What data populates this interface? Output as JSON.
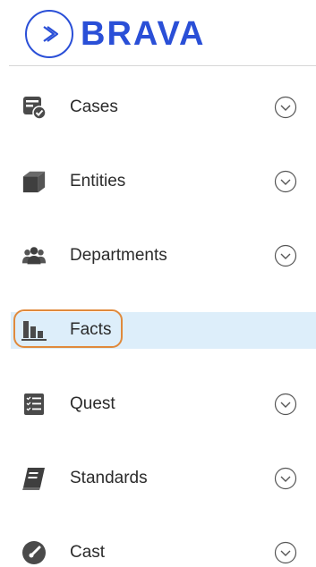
{
  "brand": {
    "name": "BRAVA"
  },
  "nav": {
    "items": [
      {
        "label": "Cases",
        "icon": "cases-icon",
        "has_chevron": true
      },
      {
        "label": "Entities",
        "icon": "cube-icon",
        "has_chevron": true
      },
      {
        "label": "Departments",
        "icon": "people-group-icon",
        "has_chevron": true
      },
      {
        "label": "Facts",
        "icon": "bar-chart-icon",
        "has_chevron": false,
        "active": true
      },
      {
        "label": "Quest",
        "icon": "checklist-icon",
        "has_chevron": true
      },
      {
        "label": "Standards",
        "icon": "book-icon",
        "has_chevron": true
      },
      {
        "label": "Cast",
        "icon": "gauge-icon",
        "has_chevron": true
      }
    ]
  },
  "colors": {
    "brand": "#2a4fd7",
    "icon": "#4a4a4a",
    "active_bg": "#ddeefa",
    "highlight": "#e08a3c"
  }
}
